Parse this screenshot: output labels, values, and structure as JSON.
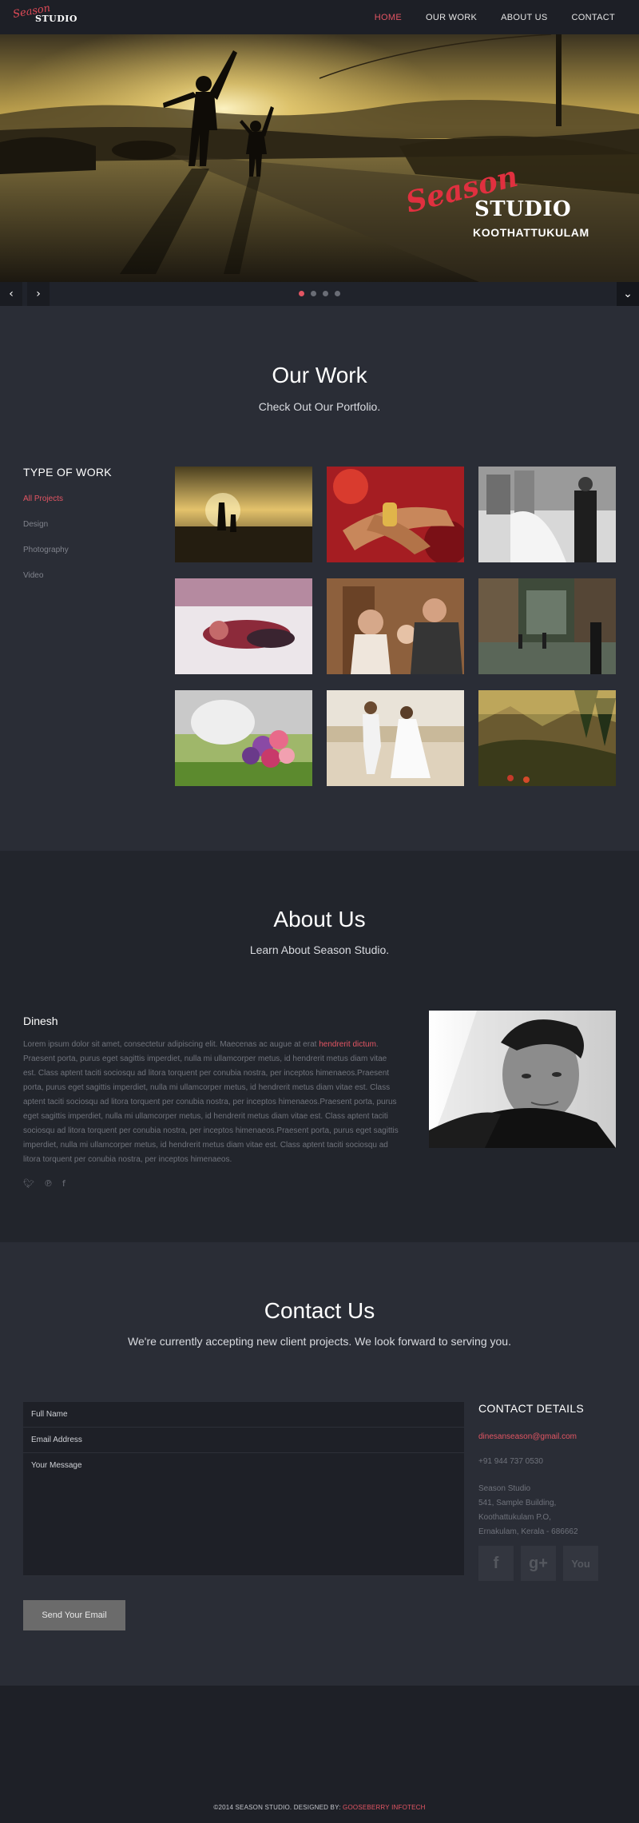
{
  "brand": {
    "script": "Season",
    "studio": "STUDIO"
  },
  "nav": [
    {
      "label": "HOME",
      "active": true
    },
    {
      "label": "OUR WORK",
      "active": false
    },
    {
      "label": "ABOUT US",
      "active": false
    },
    {
      "label": "CONTACT",
      "active": false
    }
  ],
  "hero": {
    "season": "Season",
    "studio": "STUDIO",
    "location": "KOOTHATTUKULAM"
  },
  "slider": {
    "prev_icon": "chevron-left-icon",
    "next_icon": "chevron-right-icon",
    "down_icon": "chevron-down-icon",
    "slides": 4,
    "active_slide": 1
  },
  "work": {
    "title": "Our Work",
    "subtitle": "Check Out Our Portfolio.",
    "type_title": "TYPE OF WORK",
    "filters": [
      "All Projects",
      "Design",
      "Photography",
      "Video"
    ],
    "active_filter": "All Projects"
  },
  "about": {
    "title": "About Us",
    "subtitle": "Learn About Season Studio.",
    "name": "Dinesh",
    "bio_part1": "Lorem ipsum dolor sit amet, consectetur adipiscing elit. Maecenas ac augue at erat ",
    "bio_link": "hendrerit dictum",
    "bio_part2": ". Praesent porta, purus eget sagittis imperdiet, nulla mi ullamcorper metus, id hendrerit metus diam vitae est. Class aptent taciti sociosqu ad litora torquent per conubia nostra, per inceptos himenaeos.Praesent porta, purus eget sagittis imperdiet, nulla mi ullamcorper metus, id hendrerit metus diam vitae est. Class aptent taciti sociosqu ad litora torquent per conubia nostra, per inceptos himenaeos.Praesent porta, purus eget sagittis imperdiet, nulla mi ullamcorper metus, id hendrerit metus diam vitae est. Class aptent taciti sociosqu ad litora torquent per conubia nostra, per inceptos himenaeos.Praesent porta, purus eget sagittis imperdiet, nulla mi ullamcorper metus, id hendrerit metus diam vitae est. Class aptent taciti sociosqu ad litora torquent per conubia nostra, per inceptos himenaeos.",
    "socials": [
      "twitter-icon",
      "pinterest-icon",
      "facebook-icon"
    ]
  },
  "contact": {
    "title": "Contact Us",
    "subtitle": "We're currently accepting new client projects. We look forward to serving you.",
    "full_name_placeholder": "Full Name",
    "email_placeholder": "Email Address",
    "message_placeholder": "Your Message",
    "send_label": "Send Your Email",
    "details_title": "CONTACT DETAILS",
    "email": "dinesanseason@gmail.com",
    "phone": "+91 944 737 0530",
    "address": [
      "Season Studio",
      "541, Sample Building,",
      "Koothattukulam P.O,",
      "Ernakulam, Kerala - 686662"
    ],
    "social_boxes": [
      {
        "glyph": "f",
        "icon": "facebook-icon"
      },
      {
        "glyph": "g+",
        "icon": "google-plus-icon"
      },
      {
        "glyph": "You",
        "icon": "youtube-icon"
      }
    ]
  },
  "footer": {
    "copyright": "©2014 SEASON STUDIO. DESIGNED BY: ",
    "designer": "GOOSEBERRY INFOTECH"
  },
  "colors": {
    "accent": "#e25563",
    "nav_bg": "#1d1f26",
    "section_bg": "#2a2d36",
    "about_bg": "#22252c"
  }
}
